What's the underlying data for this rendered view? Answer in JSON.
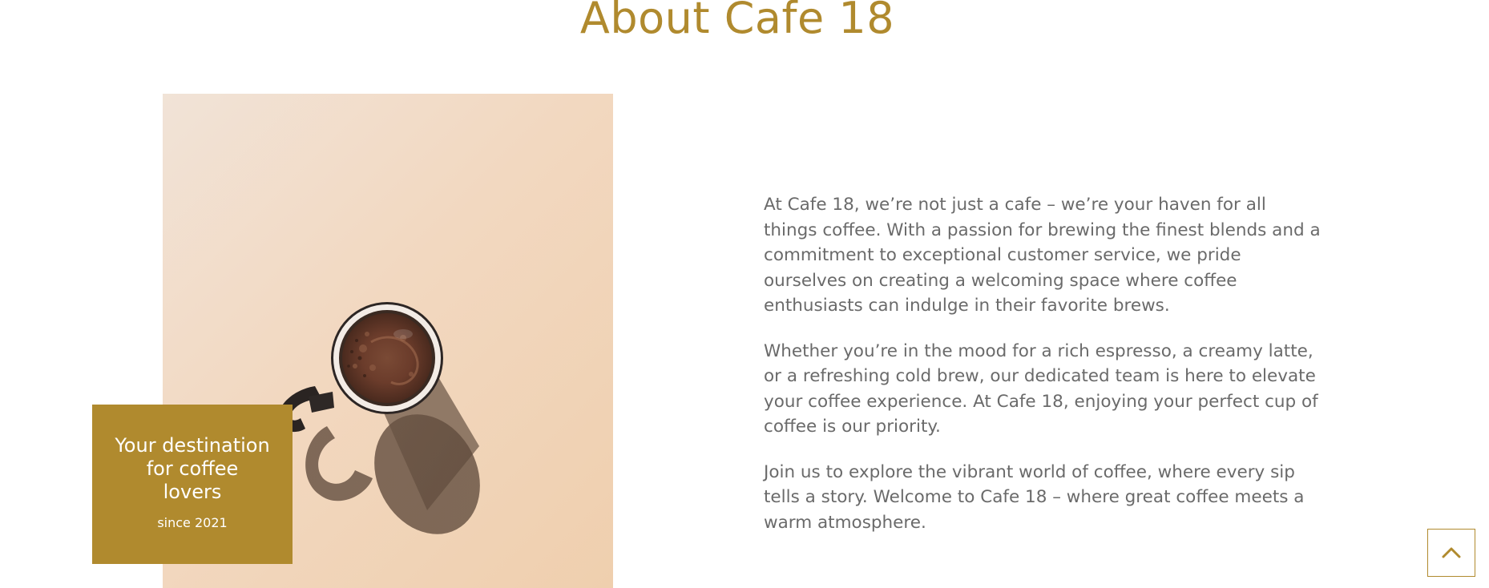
{
  "section": {
    "title": "About Cafe 18"
  },
  "badge": {
    "heading": "Your destination for coffee lovers",
    "subheading": "since 2021"
  },
  "paragraphs": [
    "At Cafe 18, we’re not just a cafe – we’re your haven for all things coffee. With a passion for brewing the finest blends and a commitment to exceptional customer service, we pride ourselves on creating a welcoming space where coffee enthusiasts can indulge in their favorite brews.",
    "Whether you’re in the mood for a rich espresso, a creamy latte, or a refreshing cold brew, our dedicated team is here to elevate your coffee experience. At Cafe 18, enjoying your perfect cup of coffee is our priority.",
    "Join us to explore the vibrant world of coffee, where every sip tells a story. Welcome to Cafe 18 – where great coffee meets a warm atmosphere."
  ],
  "icons": {
    "scroll_top": "chevron-up-icon"
  },
  "colors": {
    "accent": "#b08a2e",
    "body_text": "#6a6a6a",
    "photo_background": "#f2d8c0"
  }
}
